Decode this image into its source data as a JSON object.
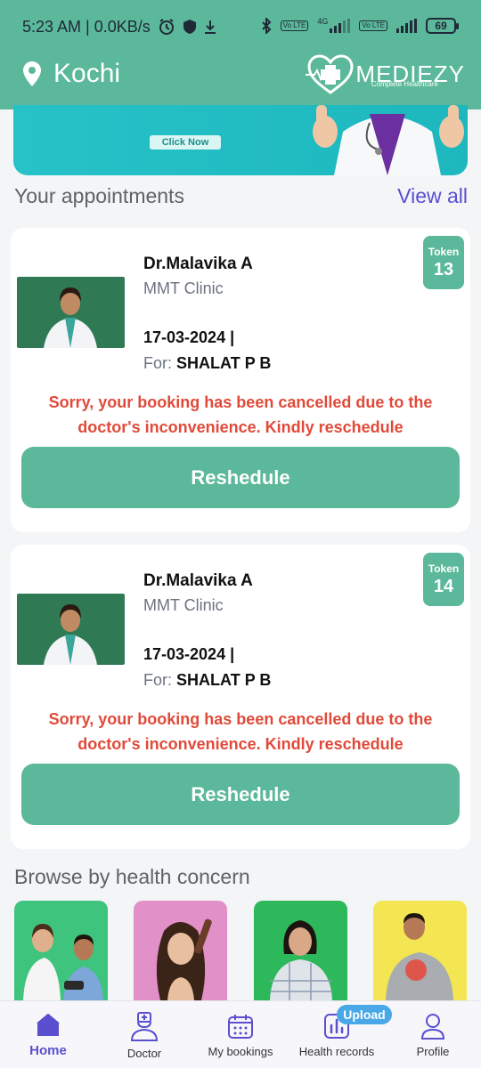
{
  "status_bar": {
    "time": "5:23 AM | 0.0KB/s",
    "battery": "69",
    "network": "4G",
    "volte": "Vo LTE"
  },
  "header": {
    "location": "Kochi",
    "brand": "MEDIEZY",
    "brand_tagline": "Complete Healthcare"
  },
  "banner": {
    "button_label": "Click Now"
  },
  "appointments": {
    "title": "Your appointments",
    "view_all": "View all",
    "items": [
      {
        "doctor": "Dr.Malavika A",
        "clinic": "MMT Clinic",
        "date": "17-03-2024 |",
        "for_label": "For:",
        "patient": "SHALAT P B",
        "token_label": "Token",
        "token_number": "13",
        "message": "Sorry, your booking has been cancelled due to the doctor's inconvenience. Kindly reschedule",
        "button": "Reshedule"
      },
      {
        "doctor": "Dr.Malavika A",
        "clinic": "MMT Clinic",
        "date": "17-03-2024 |",
        "for_label": "For:",
        "patient": "SHALAT P B",
        "token_label": "Token",
        "token_number": "14",
        "message": "Sorry, your booking has been cancelled due to the doctor's inconvenience. Kindly reschedule",
        "button": "Reshedule"
      }
    ]
  },
  "browse": {
    "title": "Browse by health concern",
    "colors": [
      "#3fc47e",
      "#e290c8",
      "#2eb85c",
      "#f4e552"
    ]
  },
  "nav": {
    "items": [
      {
        "label": "Home",
        "icon": "home-icon"
      },
      {
        "label": "Doctor",
        "icon": "doctor-icon"
      },
      {
        "label": "My bookings",
        "icon": "calendar-icon"
      },
      {
        "label": "Health records",
        "icon": "chart-icon"
      },
      {
        "label": "Profile",
        "icon": "profile-icon"
      }
    ],
    "upload_badge": "Upload"
  },
  "colors": {
    "primary": "#5bb89a",
    "accent": "#5a4fcf",
    "error": "#e04a3a"
  }
}
